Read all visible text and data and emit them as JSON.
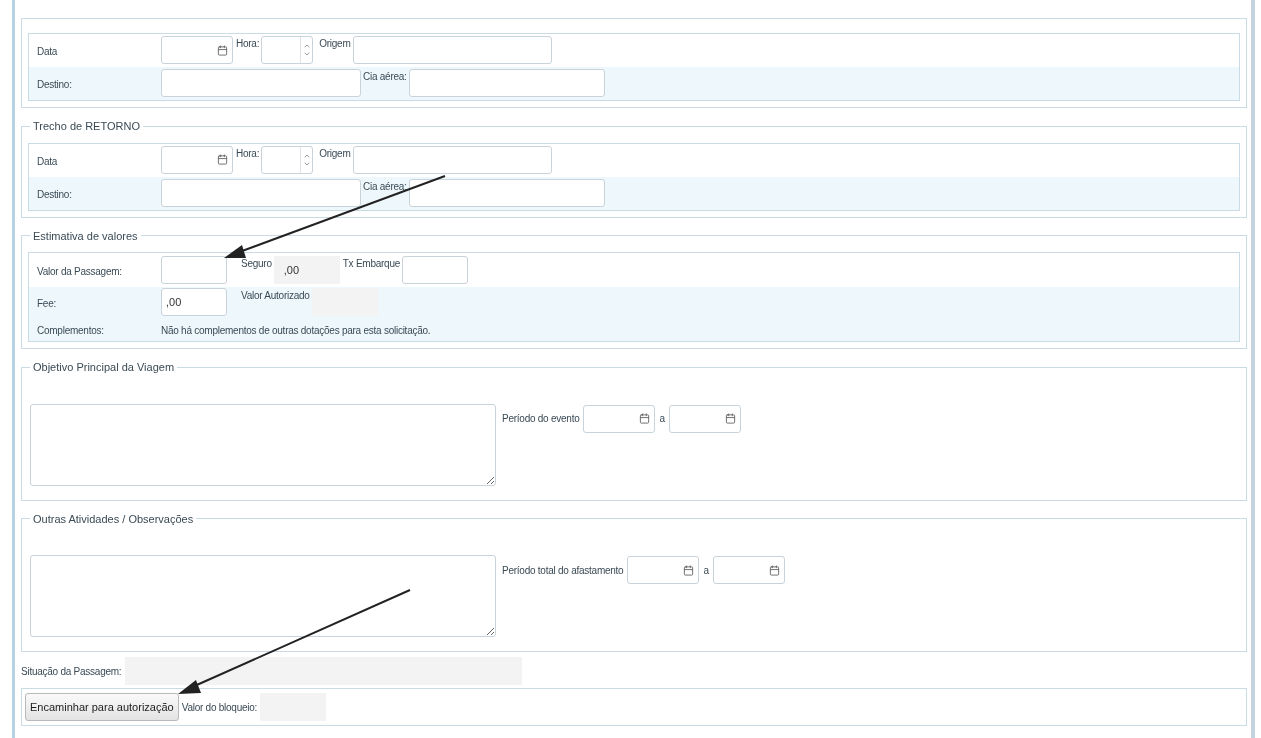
{
  "sections": [
    {
      "kind": "route",
      "date_label": "Data",
      "time_label": "Hora:",
      "origin_label": "Origem",
      "destination_label": "Destino:",
      "airline_label": "Cia aérea:"
    },
    {
      "kind": "route",
      "legend": "Trecho de RETORNO",
      "date_label": "Data",
      "time_label": "Hora:",
      "origin_label": "Origem",
      "destination_label": "Destino:",
      "airline_label": "Cia aérea:"
    },
    {
      "kind": "estimate",
      "legend": "Estimativa de valores",
      "fare_label": "Valor da Passagem:",
      "insurance_label": "Seguro",
      "insurance_value": ",00",
      "boarding_tax_label": "Tx Embarque",
      "fee_label": "Fee:",
      "fee_value": ",00",
      "authorized_label": "Valor Autorizado",
      "complements_label": "Complementos:",
      "complements_text": "Não há complementos de outras dotações para esta solicitação."
    },
    {
      "kind": "text_period",
      "legend": "Objetivo Principal da Viagem",
      "period_label": "Período do evento",
      "separator": "a"
    },
    {
      "kind": "text_period",
      "legend": "Outras Atividades / Observações",
      "period_label": "Período total do afastamento",
      "separator": "a"
    }
  ],
  "status": {
    "label": "Situação da Passagem:"
  },
  "submit": {
    "button": "Encaminhar para autorização",
    "block_label": "Valor do bloqueio:"
  }
}
